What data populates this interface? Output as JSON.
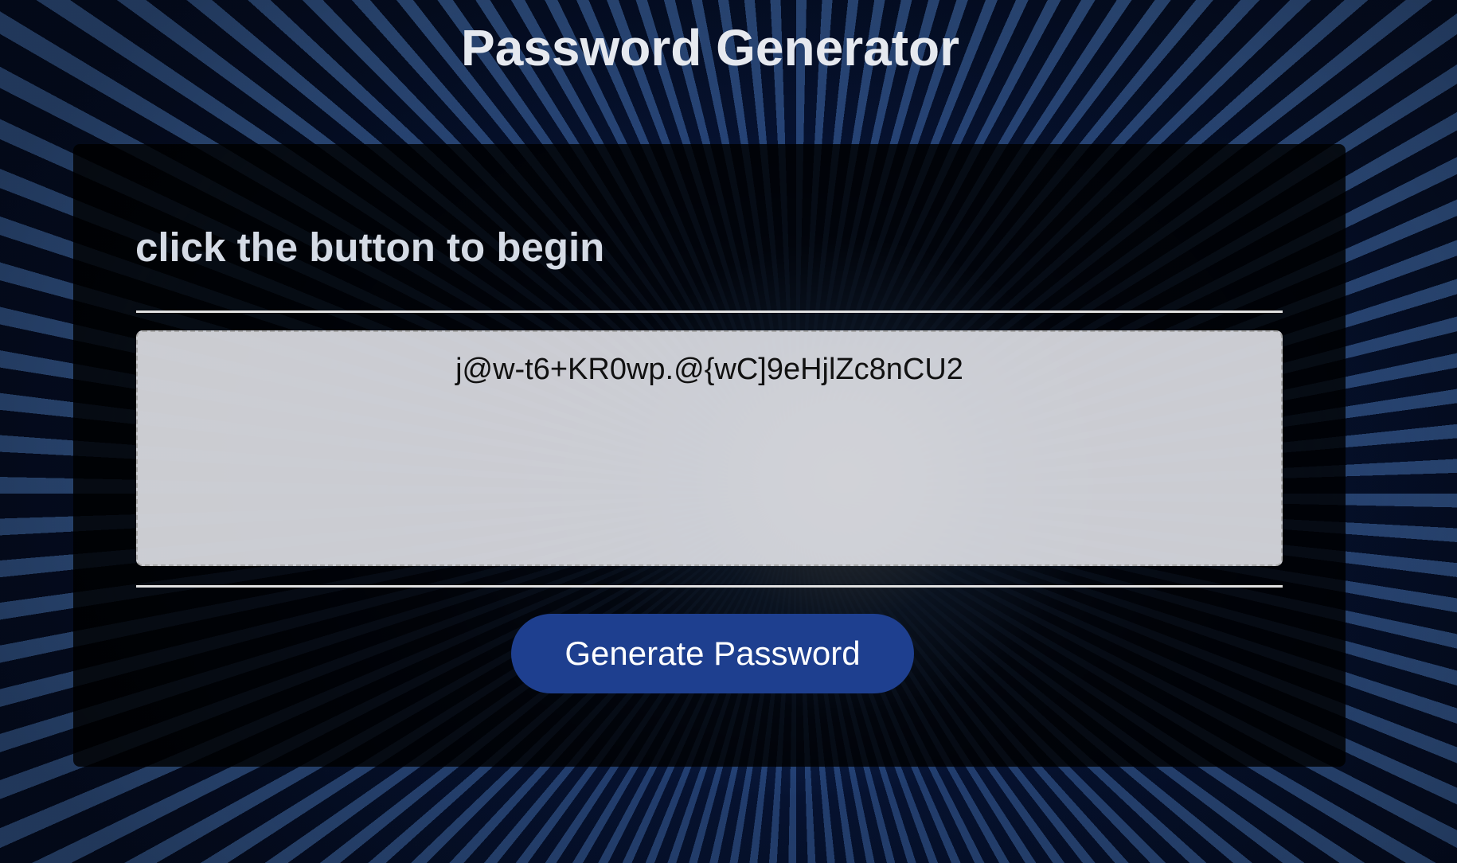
{
  "header": {
    "title": "Password Generator"
  },
  "card": {
    "heading": "click the button to begin",
    "password": {
      "value": "j@w-t6+KR0wp.@{wC]9eHjlZc8nCU2"
    },
    "generate_button": {
      "label": "Generate Password",
      "color": "#1e3f8f"
    }
  }
}
